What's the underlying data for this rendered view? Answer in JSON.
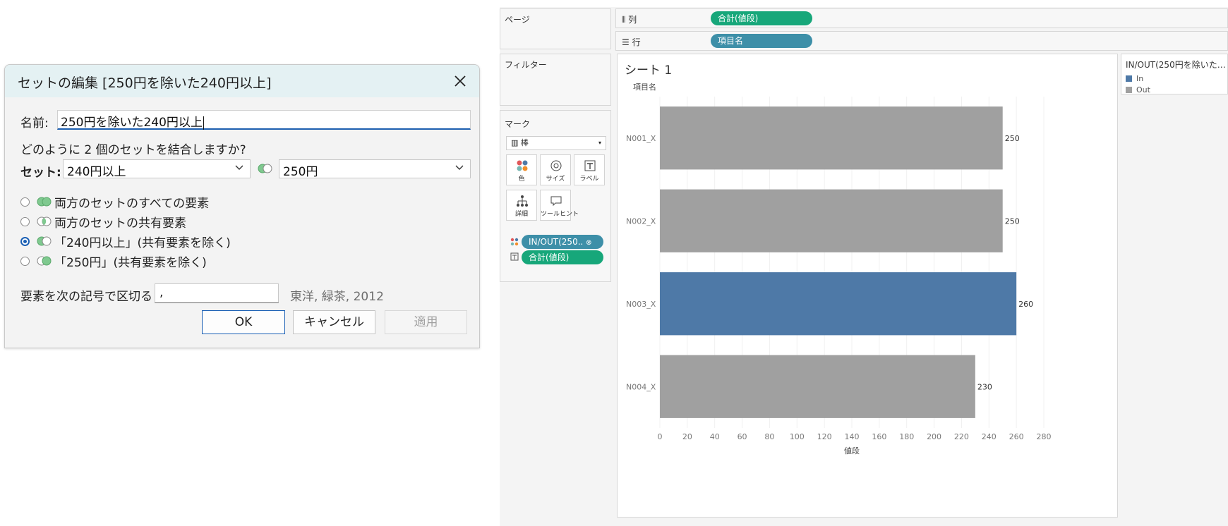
{
  "dialog": {
    "title": "セットの編集 [250円を除いた240円以上]",
    "name_label": "名前:",
    "name_value": "250円を除いた240円以上",
    "combine_question": "どのように 2 個のセットを結合しますか?",
    "sets_label": "セット:",
    "set_left": "240円以上",
    "set_right": "250円",
    "options": [
      {
        "label": "両方のセットのすべての要素",
        "checked": false
      },
      {
        "label": "両方のセットの共有要素",
        "checked": false
      },
      {
        "label": "「240円以上」(共有要素を除く)",
        "checked": true
      },
      {
        "label": "「250円」(共有要素を除く)",
        "checked": false
      }
    ],
    "separator_label": "要素を次の記号で区切る",
    "separator_value": ",",
    "separator_example": "東洋, 緑茶, 2012",
    "ok_label": "OK",
    "cancel_label": "キャンセル",
    "apply_label": "適用"
  },
  "tableau": {
    "pages_label": "ページ",
    "filters_label": "フィルター",
    "columns_label": "列",
    "rows_label": "行",
    "columns_pill": "合計(値段)",
    "rows_pill": "項目名",
    "marks_title": "マーク",
    "mark_type": "棒",
    "mark_buttons": [
      "色",
      "サイズ",
      "ラベル",
      "詳細",
      "ツールヒント"
    ],
    "marks_pills": [
      "IN/OUT(250..",
      "合計(値段)"
    ],
    "sheet_title": "シート 1",
    "legend_title": "IN/OUT(250円を除いた…",
    "legend_items": [
      {
        "label": "In",
        "color": "#4e79a7"
      },
      {
        "label": "Out",
        "color": "#a0a0a0"
      }
    ],
    "colors": {
      "green_pill": "#17a77a",
      "blue_pill": "#3d8fa8",
      "in": "#4e79a7",
      "out": "#a0a0a0"
    }
  },
  "chart_data": {
    "type": "bar",
    "orientation": "horizontal",
    "title": "シート 1",
    "row_header": "項目名",
    "xlabel": "値段",
    "categories": [
      "N001_X",
      "N002_X",
      "N003_X",
      "N004_X"
    ],
    "values": [
      250,
      250,
      260,
      230
    ],
    "groups": [
      "Out",
      "Out",
      "In",
      "Out"
    ],
    "data_labels": [
      "250",
      "250",
      "260",
      "230"
    ],
    "xlim": [
      0,
      280
    ],
    "xticks": [
      0,
      20,
      40,
      60,
      80,
      100,
      120,
      140,
      160,
      180,
      200,
      220,
      240,
      260,
      280
    ],
    "grid": true
  }
}
